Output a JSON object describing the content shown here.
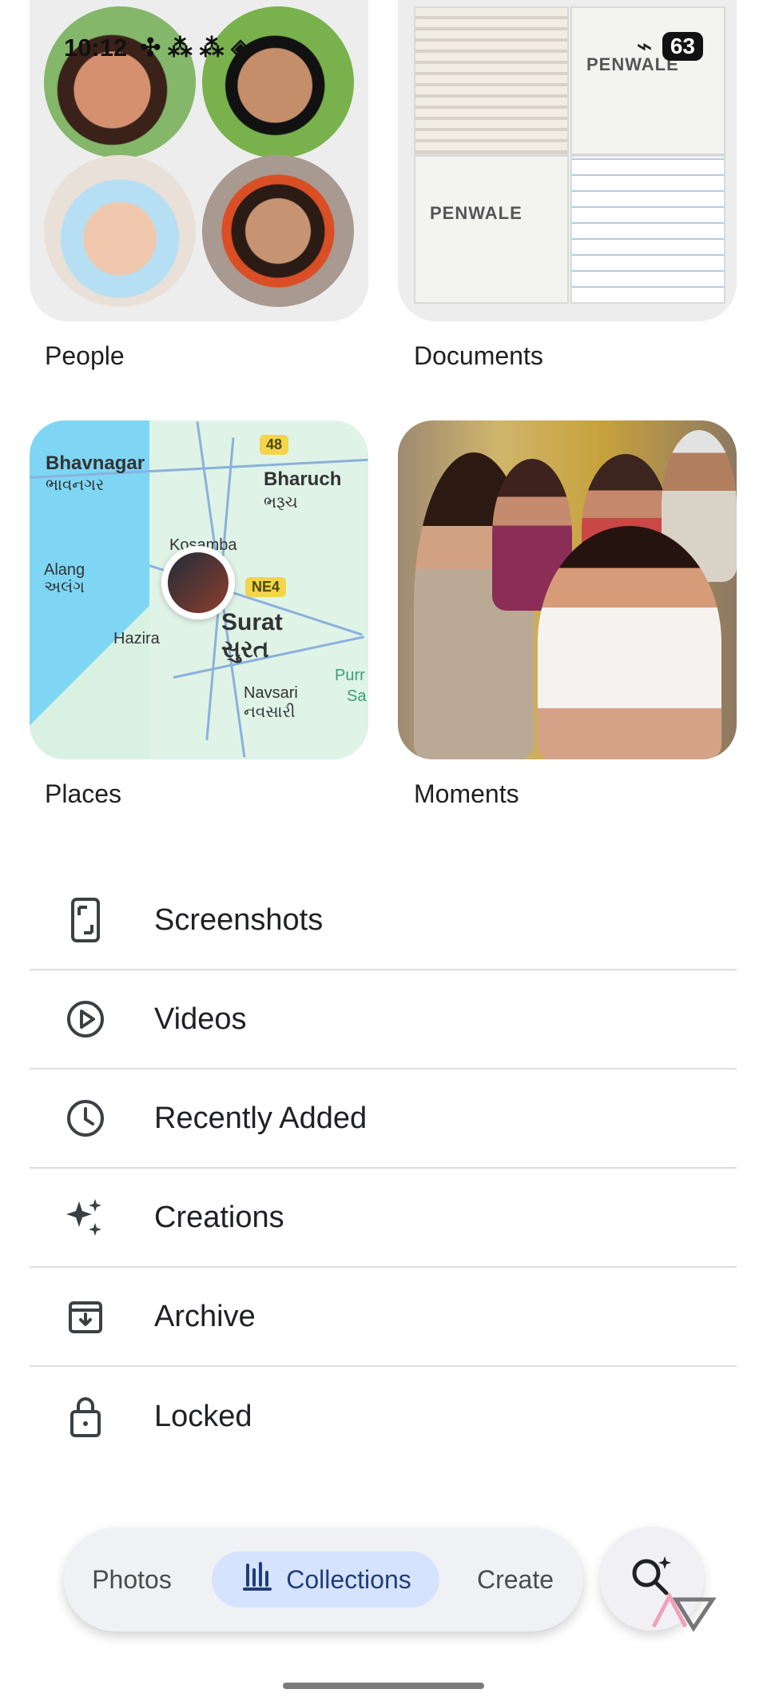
{
  "status_bar": {
    "time": "10:12",
    "battery": "63"
  },
  "collections": [
    {
      "label": "People"
    },
    {
      "label": "Documents"
    },
    {
      "label": "Places"
    },
    {
      "label": "Moments"
    }
  ],
  "map": {
    "labels": [
      "Bhavnagar",
      "ભાવનગર",
      "Bharuch",
      "ભરૂચ",
      "Kosamba",
      "Alang",
      "અલંગ",
      "Hazira",
      "Surat",
      "સુરત",
      "Navsari",
      "નવસારી",
      "Purr",
      "Sa"
    ],
    "badges": [
      "48",
      "NE4"
    ]
  },
  "documents": {
    "brand": "PENWALE"
  },
  "list": [
    {
      "label": "Screenshots",
      "icon": "screenshot-icon"
    },
    {
      "label": "Videos",
      "icon": "play-circle-icon"
    },
    {
      "label": "Recently Added",
      "icon": "clock-icon"
    },
    {
      "label": "Creations",
      "icon": "sparkle-icon"
    },
    {
      "label": "Archive",
      "icon": "archive-icon"
    },
    {
      "label": "Locked",
      "icon": "lock-icon"
    }
  ],
  "bottom_nav": {
    "items": [
      {
        "label": "Photos"
      },
      {
        "label": "Collections"
      },
      {
        "label": "Create"
      }
    ]
  }
}
